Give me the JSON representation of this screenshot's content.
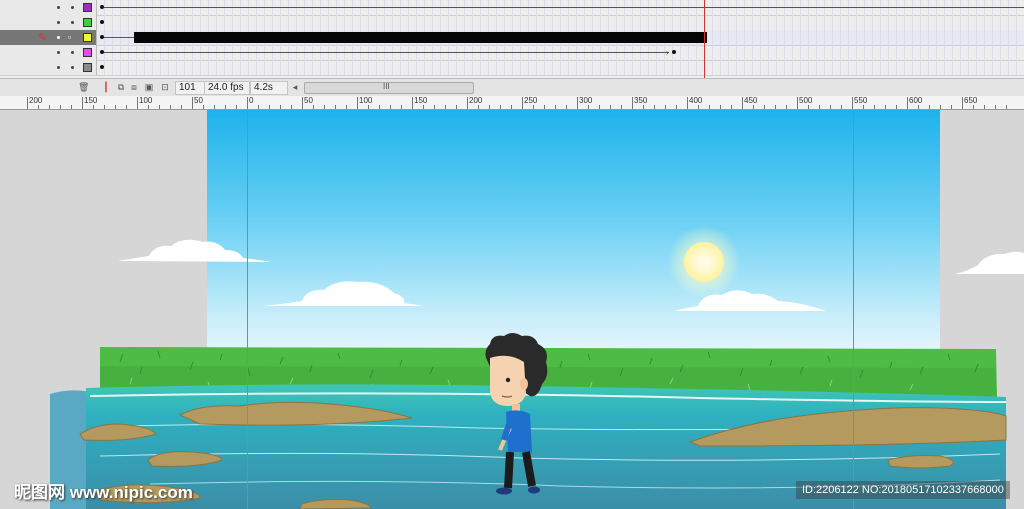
{
  "timeline": {
    "layers": [
      {
        "color": "#9b2fc4",
        "active": false
      },
      {
        "color": "#3fcf3f",
        "active": false
      },
      {
        "color": "#f4f43a",
        "active": true
      },
      {
        "color": "#e44ee4",
        "active": false
      },
      {
        "color": "#8a8a8a",
        "active": false
      }
    ],
    "footer": {
      "current_frame": "101",
      "frame_rate": "24.0 fps",
      "elapsed_time": "4.2s",
      "scroll_left_glyph": "◂",
      "scroll_grip_glyph": "III",
      "trash_glyph": "🗑"
    }
  },
  "ruler": {
    "labels": [
      "200",
      "150",
      "100",
      "50",
      "0",
      "50",
      "100",
      "150",
      "200",
      "250",
      "300",
      "350",
      "400",
      "450",
      "500",
      "550",
      "600",
      "650"
    ]
  },
  "stage": {
    "sky_color": "#1db3ec",
    "guide_color": "#3cbf3c"
  },
  "watermark": {
    "logo": "昵图网 www.nipic.com",
    "id_text": "ID:2206122 NO:20180517102337668000"
  }
}
